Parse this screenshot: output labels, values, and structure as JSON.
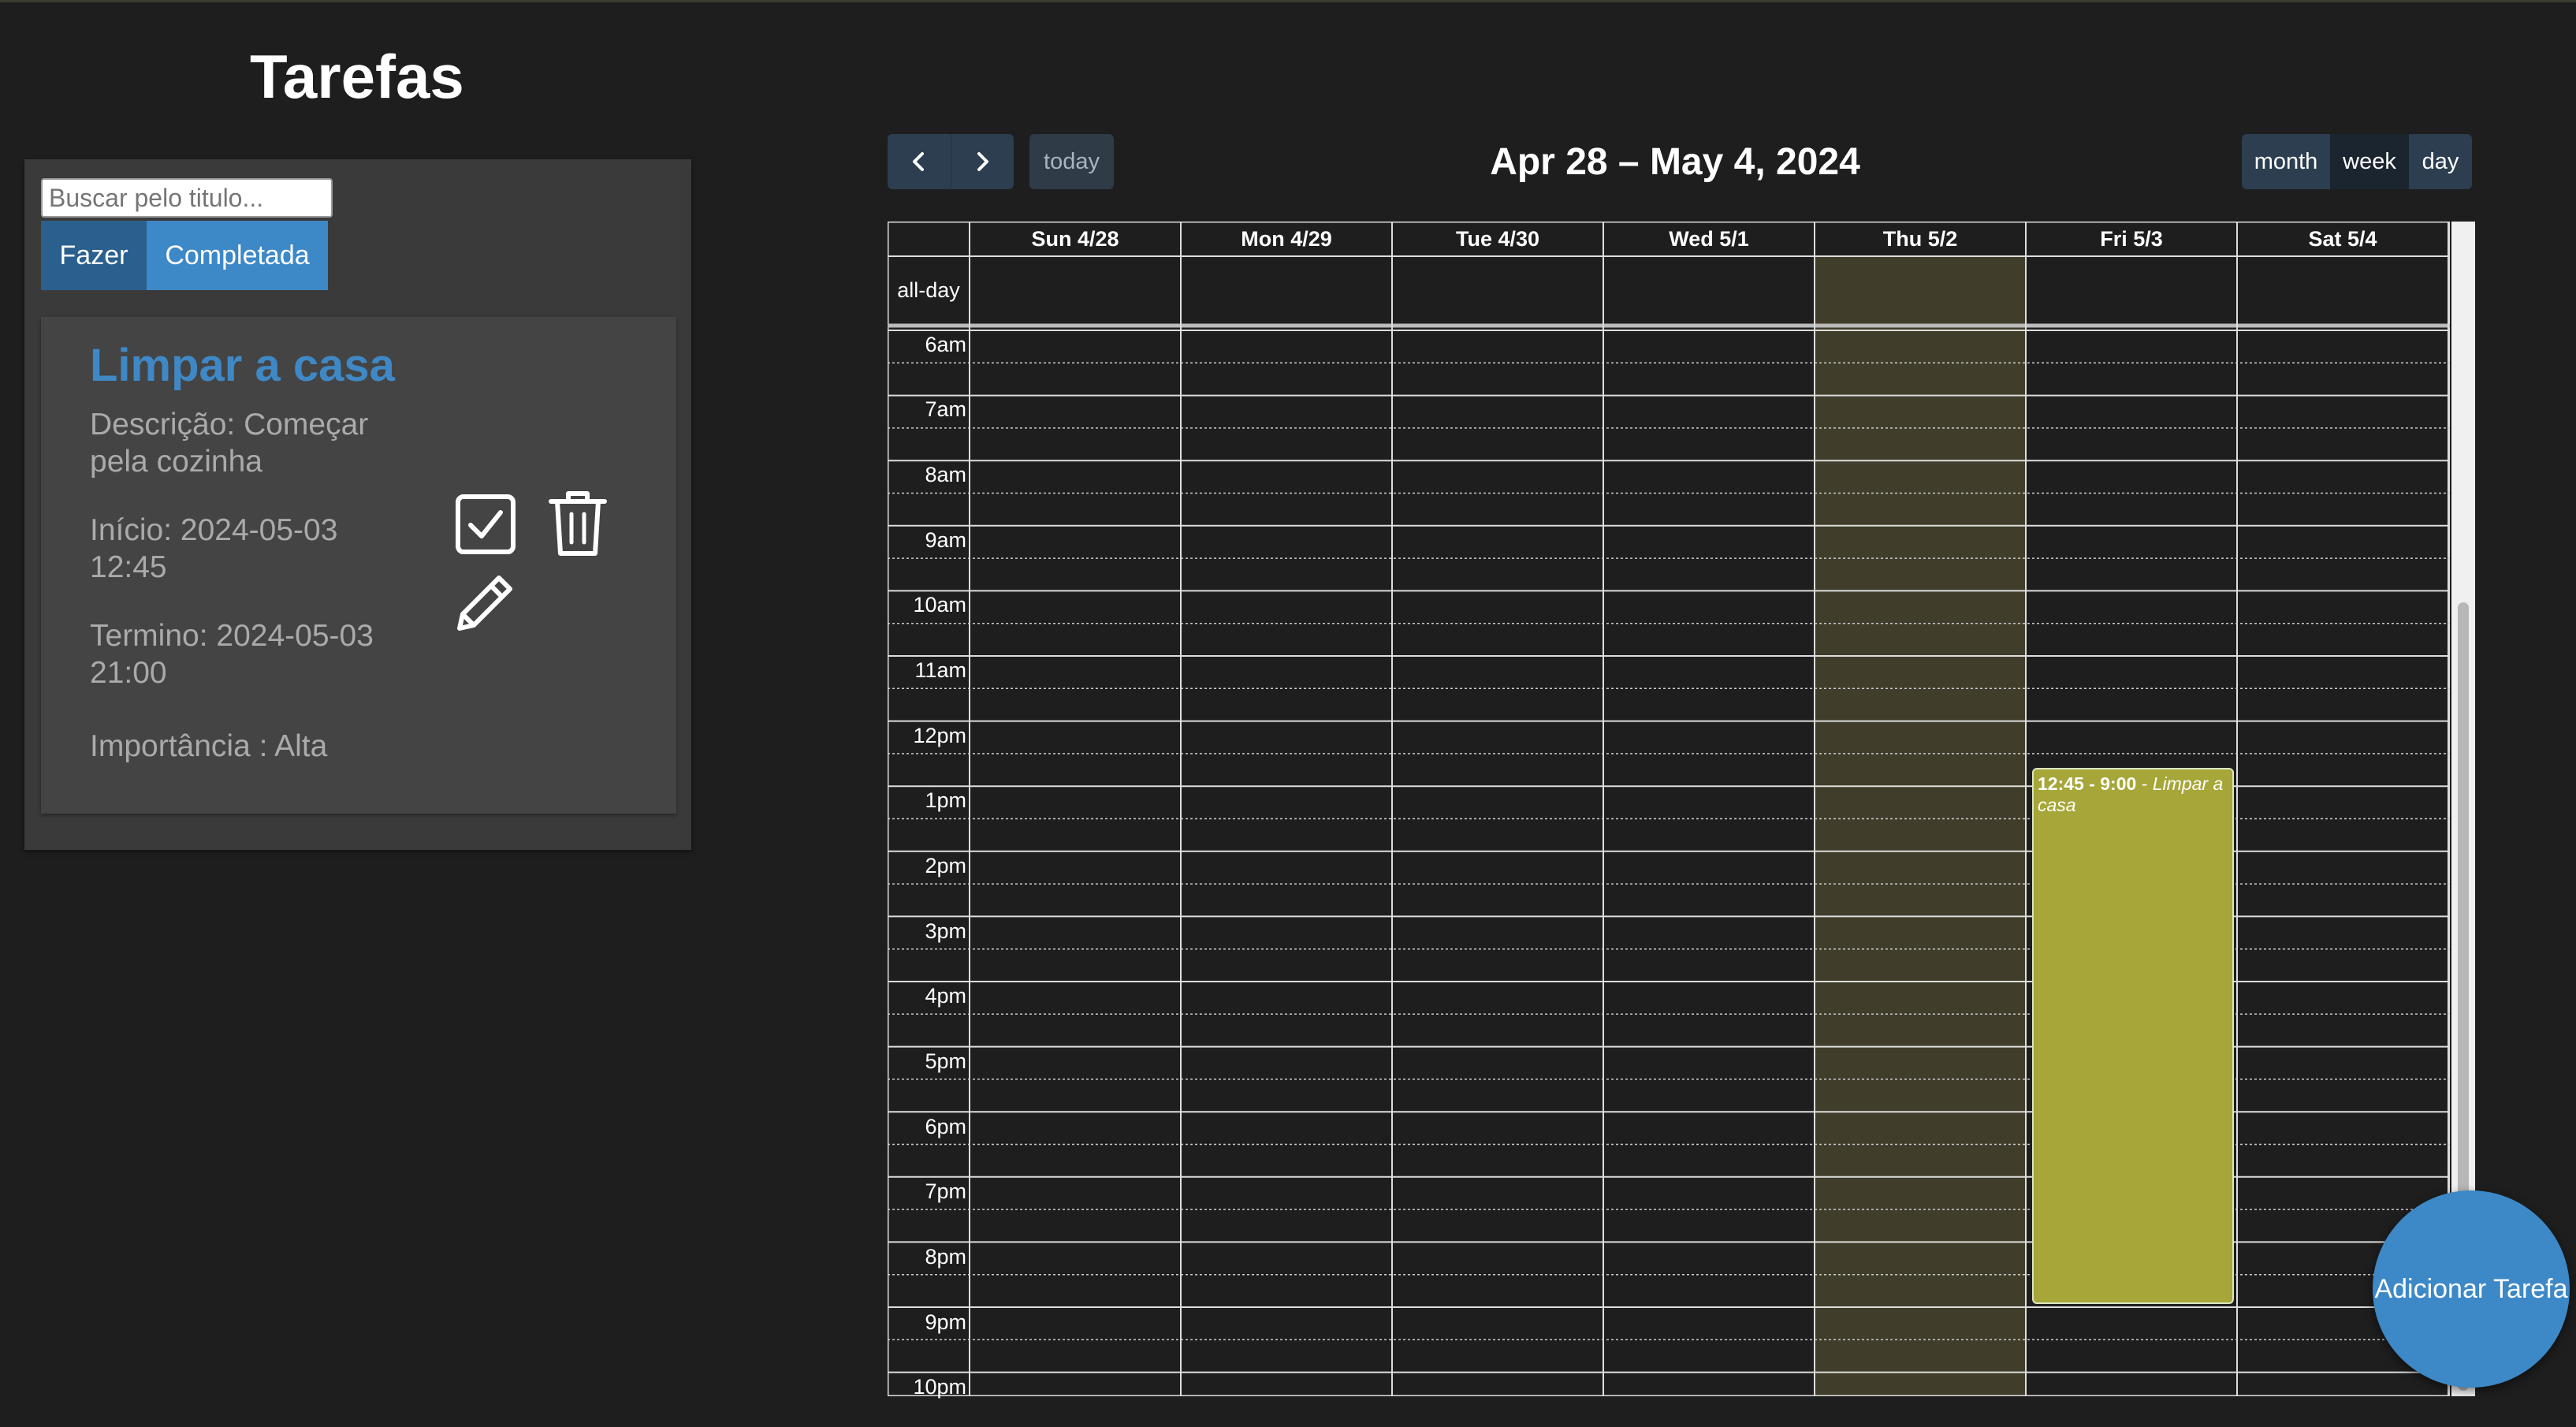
{
  "app": {
    "title": "Tarefas"
  },
  "search": {
    "placeholder": "Buscar pelo titulo..."
  },
  "filters": {
    "todo_label": "Fazer",
    "done_label": "Completada",
    "active": "Completada"
  },
  "task": {
    "title": "Limpar a casa",
    "description_label": "Descrição:",
    "description": "Começar pela cozinha",
    "start_label": "Início:",
    "start": "2024-05-03 12:45",
    "end_label": "Termino:",
    "end": "2024-05-03 21:00",
    "importance_label": "Importância :",
    "importance": "Alta",
    "actions": [
      "check-icon",
      "trash-icon",
      "pencil-icon"
    ]
  },
  "calendar": {
    "title": "Apr 28 – May 4, 2024",
    "today_label": "today",
    "prev_icon": "chevron-left-icon",
    "next_icon": "chevron-right-icon",
    "views": {
      "month": "month",
      "week": "week",
      "day": "day"
    },
    "active_view": "week",
    "days": [
      "Sun 4/28",
      "Mon 4/29",
      "Tue 4/30",
      "Wed 5/1",
      "Thu 5/2",
      "Fri 5/3",
      "Sat 5/4"
    ],
    "today_index": 4,
    "allday_label": "all-day",
    "times": [
      "6am",
      "7am",
      "8am",
      "9am",
      "10am",
      "11am",
      "12pm",
      "1pm",
      "2pm",
      "3pm",
      "4pm",
      "5pm",
      "6pm",
      "7pm",
      "8pm",
      "9pm",
      "10pm"
    ],
    "event": {
      "time": "12:45 - 9:00",
      "separator": " - ",
      "title": "Limpar a casa",
      "day_index": 5
    }
  },
  "fab": {
    "label": "Adicionar Tarefa"
  },
  "colors": {
    "background": "#1e1e1e",
    "panel": "#3a3a3a",
    "card": "#444444",
    "accent": "#3d88c7",
    "event": "#a6a639",
    "today_highlight": "#403d2a",
    "nav_button": "#2c3e50"
  }
}
